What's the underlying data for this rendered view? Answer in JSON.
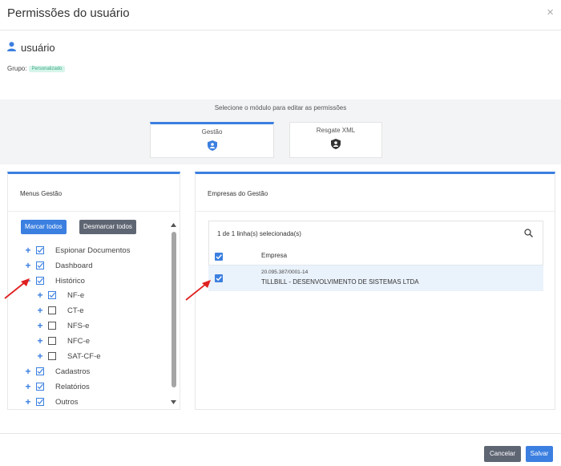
{
  "dialog": {
    "title": "Permissões do usuário",
    "close_glyph": "×"
  },
  "user": {
    "name": "usuário",
    "group_label": "Grupo:",
    "group_badge": "Personalizado"
  },
  "modules": {
    "caption": "Selecione o módulo para editar as permissões",
    "items": [
      {
        "label": "Gestão",
        "active": true,
        "icon": "shield-user-icon"
      },
      {
        "label": "Resgate XML",
        "active": false,
        "icon": "shield-user-icon"
      }
    ]
  },
  "menus": {
    "title": "Menus Gestão",
    "mark_all": "Marcar todos",
    "unmark_all": "Desmarcar todos",
    "tree": [
      {
        "label": "Espionar Documentos",
        "toggle": "+",
        "checked": true
      },
      {
        "label": "Dashboard",
        "toggle": "+",
        "checked": true
      },
      {
        "label": "Histórico",
        "toggle": "−",
        "checked": true
      },
      {
        "label": "NF-e",
        "toggle": "+",
        "checked": true
      },
      {
        "label": "CT-e",
        "toggle": "+",
        "checked": false
      },
      {
        "label": "NFS-e",
        "toggle": "+",
        "checked": false
      },
      {
        "label": "NFC-e",
        "toggle": "+",
        "checked": false
      },
      {
        "label": "SAT-CF-e",
        "toggle": "+",
        "checked": false
      },
      {
        "label": "Cadastros",
        "toggle": "+",
        "checked": true
      },
      {
        "label": "Relatórios",
        "toggle": "+",
        "checked": true
      },
      {
        "label": "Outros",
        "toggle": "+",
        "checked": true
      }
    ]
  },
  "companies": {
    "title": "Empresas do Gestão",
    "selection_text": "1 de 1 linha(s) selecionada(s)",
    "column_header": "Empresa",
    "rows": [
      {
        "cnpj": "20.095.387/0001-14",
        "name": "TILLBILL - DESENVOLVIMENTO DE SISTEMAS LTDA",
        "checked": true
      }
    ]
  },
  "footer": {
    "cancel": "Cancelar",
    "save": "Salvar"
  },
  "colors": {
    "accent": "#3b7fe0",
    "gray_button": "#5f6673",
    "annotation_arrow": "#e02020"
  }
}
